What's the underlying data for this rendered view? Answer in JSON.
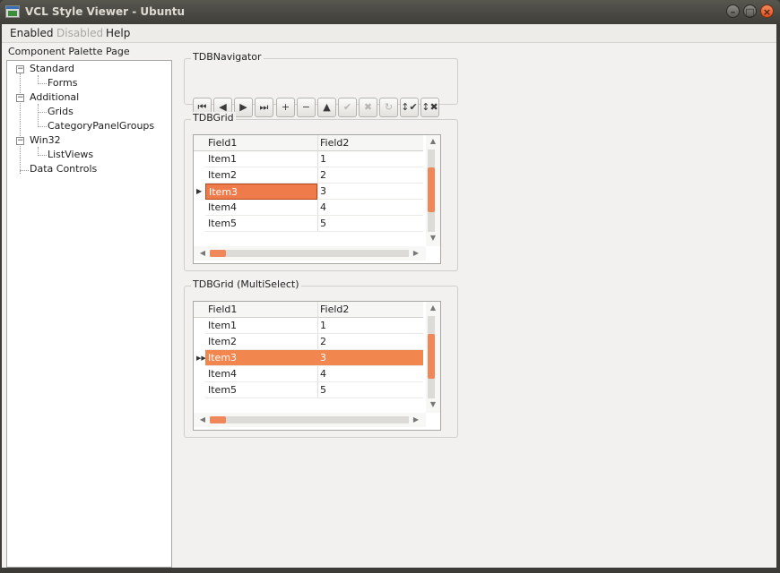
{
  "window": {
    "title": "VCL Style Viewer - Ubuntu"
  },
  "menu": {
    "items": [
      {
        "label": "Enabled",
        "disabled": false
      },
      {
        "label": "Disabled",
        "disabled": true
      },
      {
        "label": "Help",
        "disabled": false
      }
    ]
  },
  "tree": {
    "caption": "Component Palette Page",
    "nodes": [
      {
        "label": "Standard",
        "level": 0,
        "expanded": true
      },
      {
        "label": "Forms",
        "level": 1
      },
      {
        "label": "Additional",
        "level": 0,
        "expanded": true
      },
      {
        "label": "Grids",
        "level": 1
      },
      {
        "label": "CategoryPanelGroups",
        "level": 1
      },
      {
        "label": "Win32",
        "level": 0,
        "expanded": true
      },
      {
        "label": "ListViews",
        "level": 1
      },
      {
        "label": "Data Controls",
        "level": 0
      }
    ]
  },
  "navigator": {
    "title": "TDBNavigator",
    "buttons": [
      {
        "name": "first-record-icon",
        "glyph": "⏮",
        "enabled": true
      },
      {
        "name": "prior-record-icon",
        "glyph": "◀",
        "enabled": true
      },
      {
        "name": "next-record-icon",
        "glyph": "▶",
        "enabled": true
      },
      {
        "name": "last-record-icon",
        "glyph": "⏭",
        "enabled": true
      },
      {
        "name": "insert-record-icon",
        "glyph": "+",
        "enabled": true
      },
      {
        "name": "delete-record-icon",
        "glyph": "−",
        "enabled": true
      },
      {
        "name": "edit-record-icon",
        "glyph": "▲",
        "enabled": true
      },
      {
        "name": "post-record-icon",
        "glyph": "✔",
        "enabled": false
      },
      {
        "name": "cancel-record-icon",
        "glyph": "✖",
        "enabled": false
      },
      {
        "name": "refresh-icon",
        "glyph": "↻",
        "enabled": false
      },
      {
        "name": "apply-updates-icon",
        "glyph": "↕✔",
        "enabled": true
      },
      {
        "name": "cancel-updates-icon",
        "glyph": "↕✖",
        "enabled": true
      }
    ]
  },
  "grid1": {
    "title": "TDBGrid",
    "columns": [
      "Field1",
      "Field2"
    ],
    "rows": [
      [
        "Item1",
        "1"
      ],
      [
        "Item2",
        "2"
      ],
      [
        "Item3",
        "3"
      ],
      [
        "Item4",
        "4"
      ],
      [
        "Item5",
        "5"
      ]
    ],
    "selected_row": 2
  },
  "grid2": {
    "title": "TDBGrid (MultiSelect)",
    "columns": [
      "Field1",
      "Field2"
    ],
    "rows": [
      [
        "Item1",
        "1"
      ],
      [
        "Item2",
        "2"
      ],
      [
        "Item3",
        "3"
      ],
      [
        "Item4",
        "4"
      ],
      [
        "Item5",
        "5"
      ]
    ],
    "selected_row": 2
  },
  "colors": {
    "accent": "#ef7a4a",
    "titlebar": "#3c3b37",
    "close_button": "#e55b22"
  }
}
